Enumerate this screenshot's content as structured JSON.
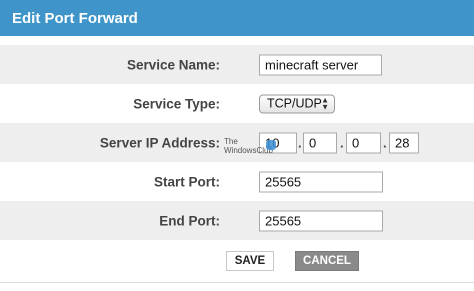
{
  "dialog": {
    "title": "Edit Port Forward"
  },
  "form": {
    "service_name": {
      "label": "Service Name:",
      "value": "minecraft server"
    },
    "service_type": {
      "label": "Service Type:",
      "value": "TCP/UDP"
    },
    "server_ip": {
      "label": "Server IP Address:",
      "octets": [
        "10",
        "0",
        "0",
        "28"
      ],
      "separator": "."
    },
    "start_port": {
      "label": "Start Port:",
      "value": "25565"
    },
    "end_port": {
      "label": "End Port:",
      "value": "25565"
    }
  },
  "watermark": {
    "line1": "The",
    "line2": "WindowsClub"
  },
  "buttons": {
    "save": "SAVE",
    "cancel": "CANCEL"
  },
  "colors": {
    "header": "#3f95c9",
    "row_shade": "#eeeeee",
    "cancel_button": "#8a8a8a"
  }
}
